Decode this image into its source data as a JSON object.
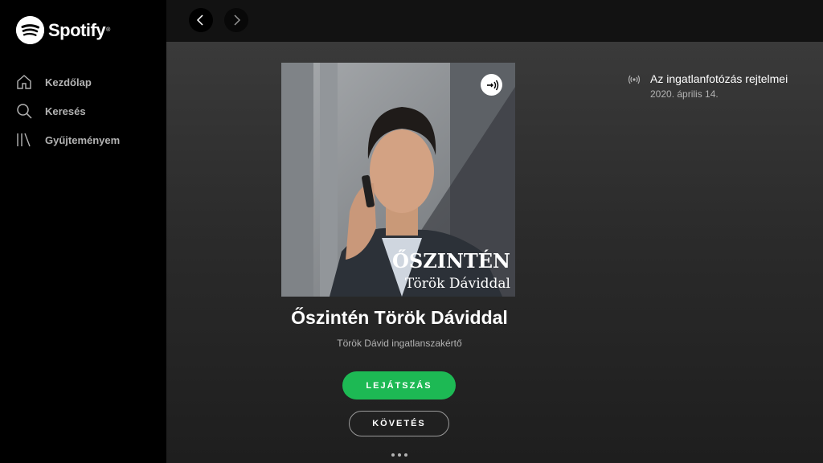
{
  "app": {
    "name": "Spotify"
  },
  "sidebar": {
    "items": [
      {
        "label": "Kezdőlap",
        "icon": "home-icon"
      },
      {
        "label": "Keresés",
        "icon": "search-icon"
      },
      {
        "label": "Gyűjteményem",
        "icon": "library-icon"
      }
    ]
  },
  "topbar": {
    "back_icon": "chevron-left-icon",
    "forward_icon": "chevron-right-icon"
  },
  "show": {
    "cover_title": "ŐSZINTÉN",
    "cover_subtitle": "Török Dáviddal",
    "title": "Őszintén Török Dáviddal",
    "author": "Török Dávid ingatlanszakértő",
    "play_label": "LEJÁTSZÁS",
    "follow_label": "KÖVETÉS"
  },
  "episode": {
    "title": "Az ingatlanfotózás rejtelmei",
    "date": "2020. április 14."
  },
  "colors": {
    "accent": "#1db954",
    "sidebar": "#000000",
    "text_secondary": "#b3b3b3"
  }
}
